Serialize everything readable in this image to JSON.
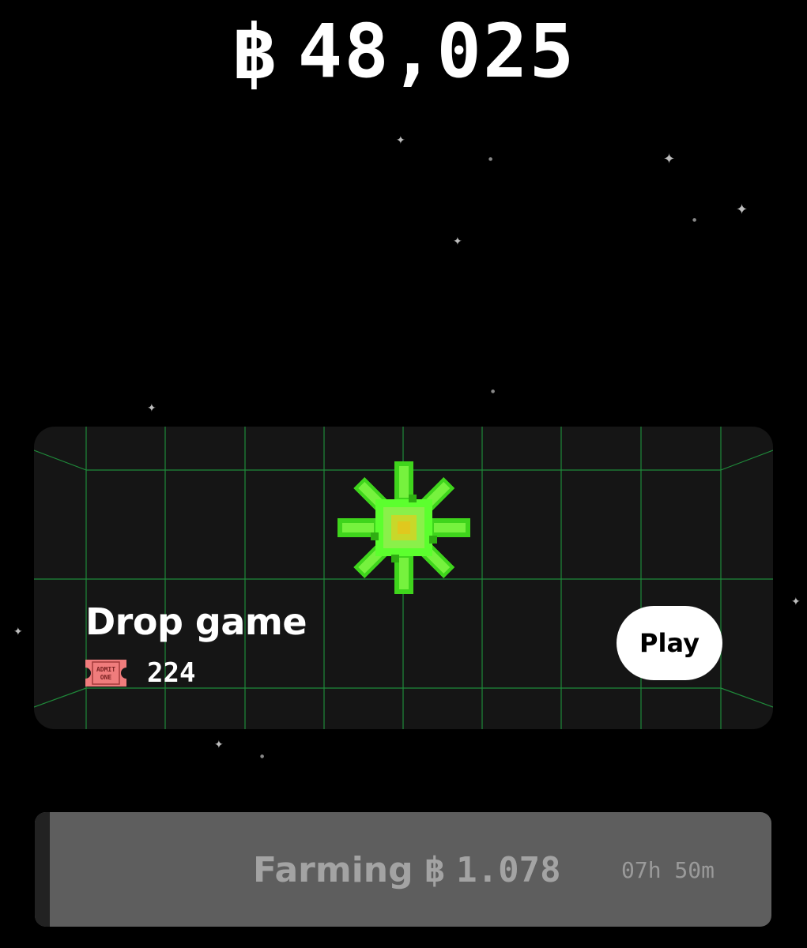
{
  "balance": {
    "coin_symbol": "฿",
    "value": "48,025"
  },
  "game_card": {
    "title": "Drop game",
    "ticket_icon": "admit-one-ticket-icon",
    "ticket_text": "ADMIT ONE",
    "ticket_count": "224",
    "play_label": "Play",
    "grid_color": "#1f8a3a",
    "artwork": "green-pixel-flower"
  },
  "farming": {
    "label": "Farming",
    "coin_symbol": "฿",
    "amount": "1.078",
    "timer": "07h 50m",
    "progress_fraction": 0.02
  },
  "colors": {
    "background": "#000000",
    "card": "#151515",
    "farming_bar": "#5e5e5e",
    "flower_green": "#5cff2e",
    "ticket_pink": "#f07c7c"
  }
}
